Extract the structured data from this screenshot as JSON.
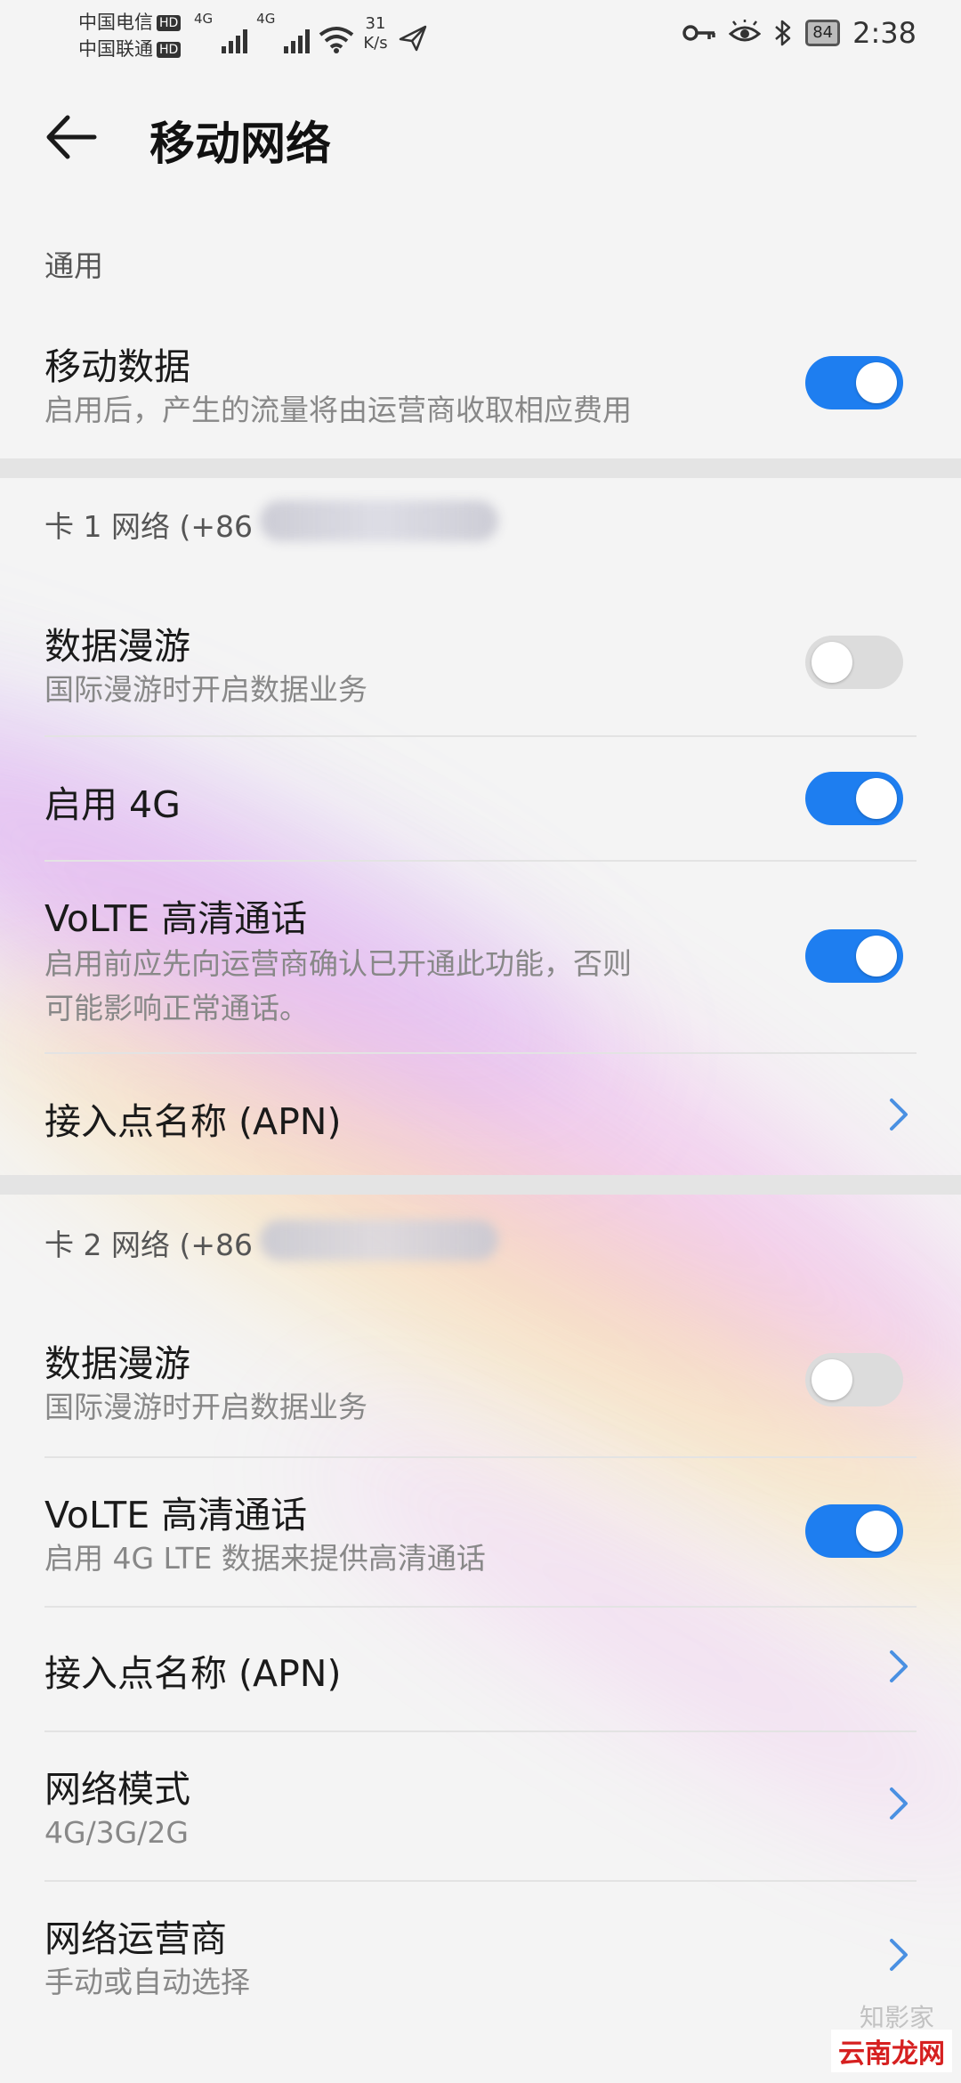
{
  "status_bar": {
    "carrier_1": "中国电信",
    "carrier_2": "中国联通",
    "hd_badge": "HD",
    "network_type": "4G",
    "speed_value": "31",
    "speed_unit": "K/s",
    "battery": "84",
    "time": "2:38"
  },
  "app_bar": {
    "title": "移动网络"
  },
  "general": {
    "section_label": "通用",
    "mobile_data": {
      "title": "移动数据",
      "subtitle": "启用后，产生的流量将由运营商收取相应费用",
      "enabled": true
    }
  },
  "sim1": {
    "section_label": "卡 1 网络 (+86",
    "data_roaming": {
      "title": "数据漫游",
      "subtitle": "国际漫游时开启数据业务",
      "enabled": false
    },
    "enable_4g": {
      "title": "启用 4G",
      "enabled": true
    },
    "volte": {
      "title": "VoLTE 高清通话",
      "subtitle_line1": "启用前应先向运营商确认已开通此功能，否则",
      "subtitle_line2": "可能影响正常通话。",
      "enabled": true
    },
    "apn": {
      "title": "接入点名称 (APN)"
    }
  },
  "sim2": {
    "section_label": "卡 2 网络 (+86",
    "data_roaming": {
      "title": "数据漫游",
      "subtitle": "国际漫游时开启数据业务",
      "enabled": false
    },
    "volte": {
      "title": "VoLTE 高清通话",
      "subtitle": "启用 4G LTE 数据来提供高清通话",
      "enabled": true
    },
    "apn": {
      "title": "接入点名称 (APN)"
    },
    "network_mode": {
      "title": "网络模式",
      "value": "4G/3G/2G"
    },
    "network_operator": {
      "title": "网络运营商",
      "subtitle": "手动或自动选择"
    }
  },
  "watermark": {
    "faint": "知影家",
    "text": "云南龙网"
  },
  "colors": {
    "toggle_on": "#1e7ef0",
    "toggle_off": "#dcdcdc",
    "chevron": "#4a90e2"
  }
}
